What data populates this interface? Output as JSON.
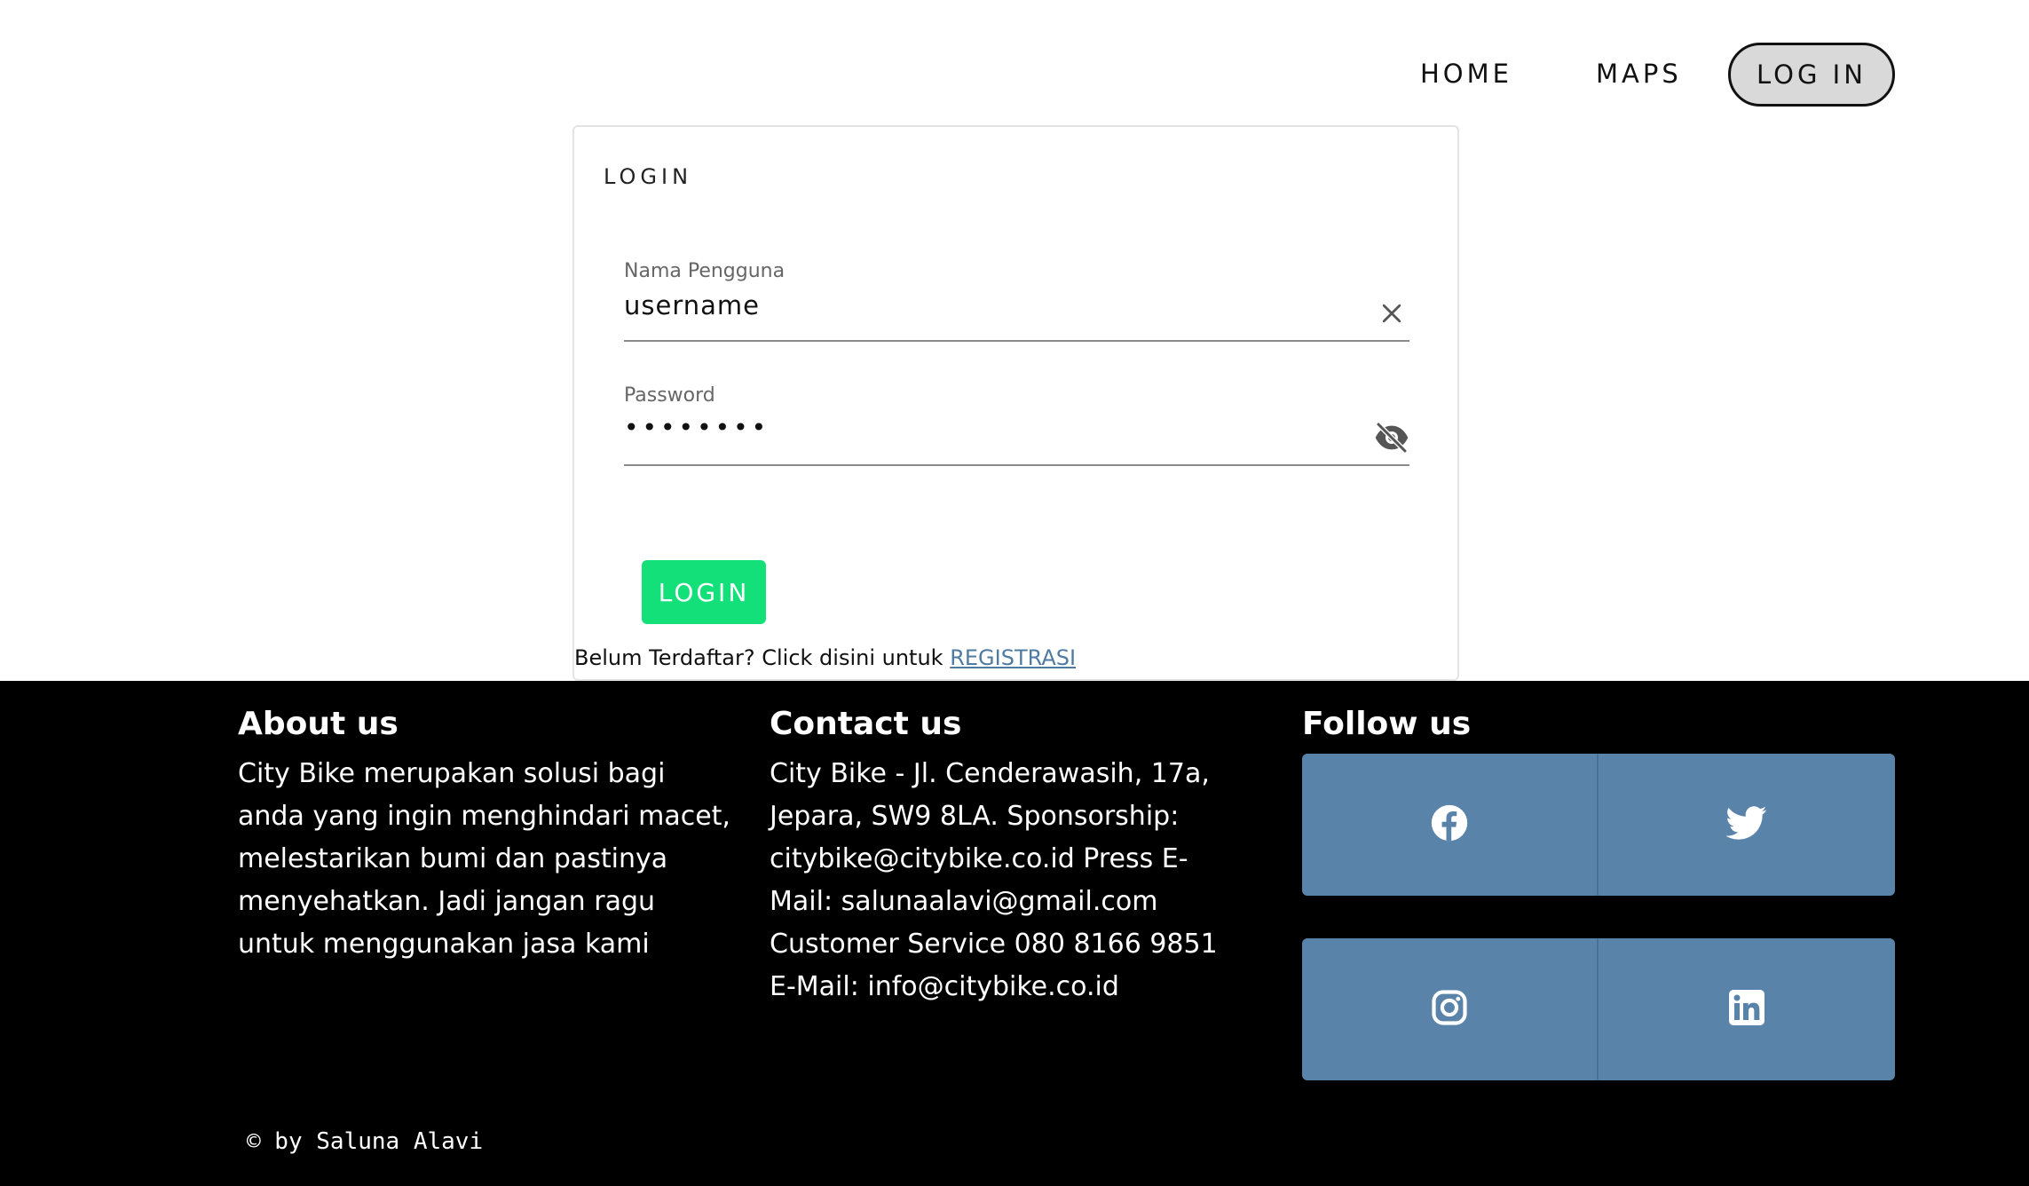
{
  "nav": {
    "home": "HOME",
    "maps": "MAPS",
    "login": "LOG IN"
  },
  "card": {
    "title": "LOGIN",
    "username": {
      "label": "Nama Pengguna",
      "value": "username",
      "icon": "close-icon"
    },
    "password": {
      "label": "Password",
      "value": "••••••••",
      "icon": "eye-off-icon"
    },
    "submit": "LOGIN",
    "register_prompt": "Belum Terdaftar? Click disini untuk ",
    "register_link": "REGISTRASI"
  },
  "footer": {
    "about": {
      "heading": "About us",
      "text": "City Bike merupakan solusi bagi anda yang ingin menghindari macet, melestarikan bumi dan pastinya menyehatkan. Jadi jangan ragu untuk menggunakan jasa kami"
    },
    "contact": {
      "heading": "Contact us",
      "text": "City Bike - Jl. Cenderawasih, 17a, Jepara, SW9 8LA. Sponsorship: citybike@citybike.co.id Press E-Mail: salunaalavi@gmail.com Customer Service 080 8166 9851 E-Mail: info@citybike.co.id"
    },
    "follow": {
      "heading": "Follow us",
      "icons": [
        "facebook-icon",
        "twitter-icon",
        "instagram-icon",
        "linkedin-icon"
      ]
    },
    "copyright": "© by Saluna Alavi"
  },
  "colors": {
    "login_button": "#14e07a",
    "social_bg": "#5a83aa",
    "link": "#4f7ba3",
    "footer_bg": "#000000"
  }
}
